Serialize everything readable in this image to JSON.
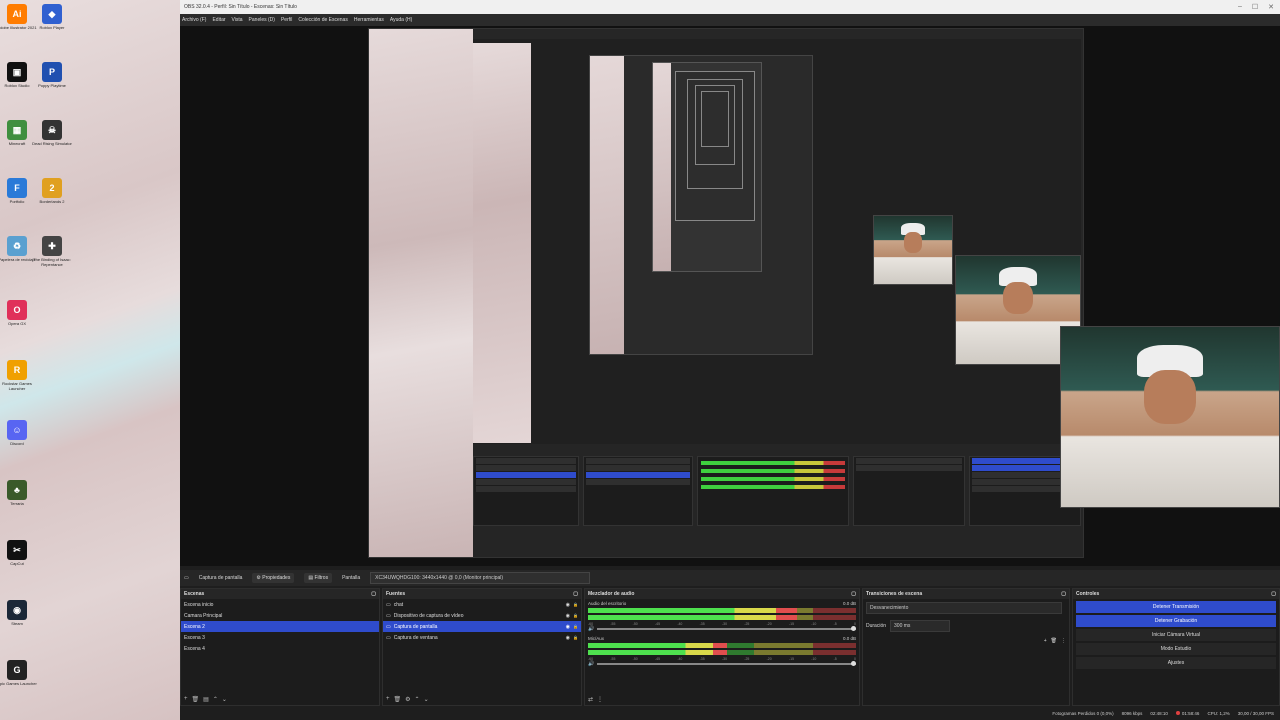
{
  "window": {
    "title": "OBS 32.0.4 - Perfil: Sin Título - Escenas: Sin Título"
  },
  "menu": [
    "Archivo (F)",
    "Editar",
    "Vista",
    "Paneles (D)",
    "Perfil",
    "Colección de Escenas",
    "Herramientas",
    "Ayuda (H)"
  ],
  "desktop_icons": [
    {
      "label": "Adobe Illustrator 2021",
      "glyph": "Ai",
      "color": "#ff7c00"
    },
    {
      "label": "Roblox Player",
      "glyph": "◆",
      "color": "#3060d0"
    },
    {
      "label": "Roblox Studio",
      "glyph": "▣",
      "color": "#111111"
    },
    {
      "label": "Poppy Playtime",
      "glyph": "P",
      "color": "#2050b0"
    },
    {
      "label": "Minecraft",
      "glyph": "▦",
      "color": "#3f8f3f"
    },
    {
      "label": "Dead Rising Simulator",
      "glyph": "☠",
      "color": "#333333"
    },
    {
      "label": "Portfolio",
      "glyph": "F",
      "color": "#2a7ad8"
    },
    {
      "label": "Borderlands 2",
      "glyph": "2",
      "color": "#e0a020"
    },
    {
      "label": "Papelera de reciclaje",
      "glyph": "♻",
      "color": "#5aa0d0"
    },
    {
      "label": "The Binding of Isaac: Repentance",
      "glyph": "✚",
      "color": "#444444"
    },
    {
      "label": "Opera GX",
      "glyph": "O",
      "color": "#e0305a"
    },
    {
      "label": "Rockstar Games Launcher",
      "glyph": "R",
      "color": "#f0a000"
    },
    {
      "label": "Discord",
      "glyph": "☺",
      "color": "#5865f2"
    },
    {
      "label": "Terraria",
      "glyph": "♣",
      "color": "#3a5a2a"
    },
    {
      "label": "CapCut",
      "glyph": "✂",
      "color": "#111111"
    },
    {
      "label": "Steam",
      "glyph": "◉",
      "color": "#1b2838"
    },
    {
      "label": "Epic Games Launcher",
      "glyph": "G",
      "color": "#222222"
    }
  ],
  "source_bar": {
    "source_name": "Captura de pantalla",
    "properties": "Propiedades",
    "filters": "Filtros",
    "screen_label": "Pantalla",
    "screen_value": "XC34UWQHDG100: 3440x1440 @ 0,0 (Monitor principal)"
  },
  "scenes": {
    "title": "Escenas",
    "items": [
      "Escena inicio",
      "Camara Principal",
      "Escena 2",
      "Escena 3",
      "Escena 4"
    ],
    "selected": 2
  },
  "sources": {
    "title": "Fuentes",
    "items": [
      "chat",
      "Dispositivo de captura de vídeo",
      "Captura de pantalla",
      "Captura de ventana"
    ],
    "selected": 2
  },
  "mixer": {
    "title": "Mezclador de audio",
    "channels": [
      {
        "name": "Audio del escritorio",
        "db": "0.0 dB",
        "level": 0.78
      },
      {
        "name": "Mic/Aux",
        "db": "0.0 dB",
        "level": 0.52
      }
    ],
    "ticks": [
      "-60",
      "-55",
      "-50",
      "-45",
      "-40",
      "-35",
      "-30",
      "-25",
      "-20",
      "-15",
      "-10",
      "-5",
      "0"
    ]
  },
  "transitions": {
    "title": "Transiciones de escena",
    "type": "Desvanecimiento",
    "duration_label": "Duración",
    "duration_value": "300 ms"
  },
  "controls": {
    "title": "Controles",
    "buttons": [
      {
        "label": "Detener Transmisión",
        "active": true
      },
      {
        "label": "Detener Grabación",
        "active": true
      },
      {
        "label": "Iniciar Cámara Virtual",
        "active": false
      },
      {
        "label": "Modo Estudio",
        "active": false
      },
      {
        "label": "Ajustes",
        "active": false
      }
    ]
  },
  "status": {
    "dropped": "Fotogramas Perdidos 0 (0,0%)",
    "bitrate": "8096 kbps",
    "stream_time": "02:48:10",
    "rec_time": "01:58:46",
    "cpu": "CPU: 1,2%",
    "fps": "30,00 / 30,00 FPS"
  }
}
